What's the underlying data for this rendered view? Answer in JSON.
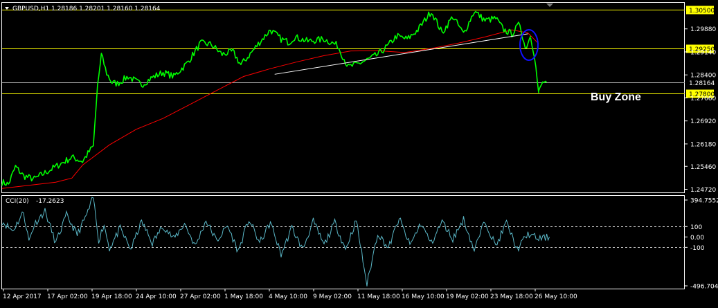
{
  "header": {
    "symbol_line": "GBPUSD,H1  1.28186 1.28201 1.28160 1.28164",
    "dropdown_icon": "triangle-down-icon"
  },
  "annotations": {
    "buy_zone_label": "Buy Zone"
  },
  "colors": {
    "background": "#000000",
    "price": "#00ff00",
    "moving_average": "#ff0000",
    "trendline": "#ffffff",
    "highlight_ellipse": "#1010ff",
    "level_line": "#ffff00",
    "cci": "#5bb9c9"
  },
  "chart_data": [
    {
      "type": "line",
      "title": "GBPUSD,H1",
      "ohlc": {
        "open": "1.28186",
        "high": "1.28201",
        "low": "1.28160",
        "close": "1.28164"
      },
      "ylim": [
        1.2462,
        1.3072
      ],
      "y_ticks": [
        "1.30500",
        "1.29880",
        "1.29250",
        "1.29140",
        "1.28400",
        "1.28164",
        "1.27800",
        "1.27660",
        "1.26920",
        "1.26180",
        "1.25460",
        "1.24720"
      ],
      "x_ticks": [
        "12 Apr 2017",
        "17 Apr 02:00",
        "19 Apr 18:00",
        "24 Apr 10:00",
        "27 Apr 02:00",
        "1 May 18:00",
        "4 May 10:00",
        "9 May 02:00",
        "11 May 18:00",
        "16 May 10:00",
        "19 May 02:00",
        "23 May 18:00",
        "26 May 10:00"
      ],
      "horizontal_levels": [
        {
          "value": 1.305,
          "label": "1.30500",
          "color": "#ffff00",
          "highlight": true
        },
        {
          "value": 1.2925,
          "label": "1.29250",
          "color": "#ffff00",
          "highlight": true
        },
        {
          "value": 1.28164,
          "label": "1.28164",
          "color": "#b0b0b0",
          "highlight": false
        },
        {
          "value": 1.278,
          "label": "1.27800",
          "color": "#ffff00",
          "highlight": true
        }
      ],
      "trendline": {
        "from": [
          0.508,
          1.2842
        ],
        "to": [
          0.98,
          1.2972
        ]
      },
      "grid": false,
      "series": [
        {
          "role": "price",
          "x": [
            0.0,
            0.012,
            0.025,
            0.04,
            0.06,
            0.08,
            0.1,
            0.13,
            0.15,
            0.17,
            0.178,
            0.185,
            0.195,
            0.205,
            0.215,
            0.235,
            0.26,
            0.28,
            0.3,
            0.32,
            0.345,
            0.37,
            0.39,
            0.41,
            0.43,
            0.445,
            0.46,
            0.48,
            0.5,
            0.52,
            0.535,
            0.545,
            0.57,
            0.6,
            0.625,
            0.645,
            0.66,
            0.68,
            0.7,
            0.72,
            0.735,
            0.755,
            0.775,
            0.8,
            0.82,
            0.84,
            0.86,
            0.88,
            0.9,
            0.92,
            0.935,
            0.95,
            0.965,
            0.975,
            0.985
          ],
          "values": [
            1.2495,
            1.2488,
            1.2545,
            1.2515,
            1.2505,
            1.2525,
            1.2545,
            1.2575,
            1.2562,
            1.2612,
            1.2805,
            1.2905,
            1.2845,
            1.2815,
            1.2812,
            1.2835,
            1.2808,
            1.2832,
            1.2848,
            1.2835,
            1.2878,
            1.2942,
            1.2938,
            1.2906,
            1.2915,
            1.2872,
            1.2902,
            1.2945,
            1.2985,
            1.2955,
            1.2945,
            1.2962,
            1.2948,
            1.2955,
            1.2935,
            1.2865,
            1.2873,
            1.2888,
            1.2905,
            1.2935,
            1.2965,
            1.2955,
            1.2985,
            1.3045,
            1.2975,
            1.3028,
            1.2972,
            1.3045,
            1.3015,
            1.3022,
            1.2985,
            1.2972,
            1.3005,
            1.2925,
            1.2965
          ]
        },
        {
          "role": "price_decline",
          "x": [
            0.985,
            0.992,
            1.0
          ],
          "values": [
            1.2965,
            1.2905,
            1.2782
          ]
        },
        {
          "role": "price_rebound",
          "x": [
            1.0,
            1.005,
            1.01,
            1.015
          ],
          "values": [
            1.2782,
            1.2808,
            1.2818,
            1.2816
          ]
        },
        {
          "role": "moving_average",
          "x": [
            0.0,
            0.05,
            0.1,
            0.13,
            0.15,
            0.2,
            0.25,
            0.3,
            0.35,
            0.4,
            0.45,
            0.5,
            0.55,
            0.6,
            0.65,
            0.7,
            0.75,
            0.8,
            0.85,
            0.9,
            0.95,
            0.98,
            1.0
          ],
          "values": [
            1.2475,
            1.2485,
            1.2495,
            1.2508,
            1.255,
            1.2615,
            1.2665,
            1.27,
            1.2745,
            1.279,
            1.2835,
            1.286,
            1.2882,
            1.2902,
            1.2917,
            1.2918,
            1.2912,
            1.2925,
            1.2942,
            1.2962,
            1.2985,
            1.2975,
            1.294
          ]
        }
      ]
    },
    {
      "type": "line",
      "title": "CCI(20)",
      "current_value": "-17.2623",
      "ylim": [
        -496.704,
        394.7552
      ],
      "y_ticks": [
        "394.7552",
        "100",
        "0.00",
        "-100",
        "-496.704"
      ],
      "reference_levels": [
        100,
        -100
      ],
      "series": [
        {
          "role": "cci",
          "x": [
            0.0,
            0.02,
            0.04,
            0.05,
            0.06,
            0.08,
            0.1,
            0.12,
            0.14,
            0.16,
            0.17,
            0.18,
            0.19,
            0.2,
            0.22,
            0.24,
            0.26,
            0.28,
            0.3,
            0.32,
            0.34,
            0.36,
            0.38,
            0.4,
            0.42,
            0.44,
            0.46,
            0.48,
            0.5,
            0.52,
            0.54,
            0.56,
            0.58,
            0.6,
            0.62,
            0.64,
            0.66,
            0.68,
            0.7,
            0.72,
            0.74,
            0.76,
            0.78,
            0.8,
            0.82,
            0.84,
            0.86,
            0.88,
            0.9,
            0.92,
            0.94,
            0.96,
            0.98,
            1.0,
            1.02
          ],
          "values": [
            150,
            60,
            240,
            -40,
            120,
            250,
            -60,
            210,
            20,
            240,
            380,
            -30,
            120,
            -110,
            80,
            -120,
            150,
            -60,
            110,
            -20,
            130,
            -90,
            160,
            -40,
            110,
            -140,
            170,
            -60,
            140,
            -170,
            90,
            -120,
            150,
            -80,
            140,
            -120,
            160,
            -460,
            40,
            -110,
            180,
            -80,
            130,
            -60,
            150,
            -20,
            170,
            -130,
            160,
            -90,
            140,
            -120,
            30,
            -17.2623,
            0
          ]
        }
      ]
    }
  ]
}
